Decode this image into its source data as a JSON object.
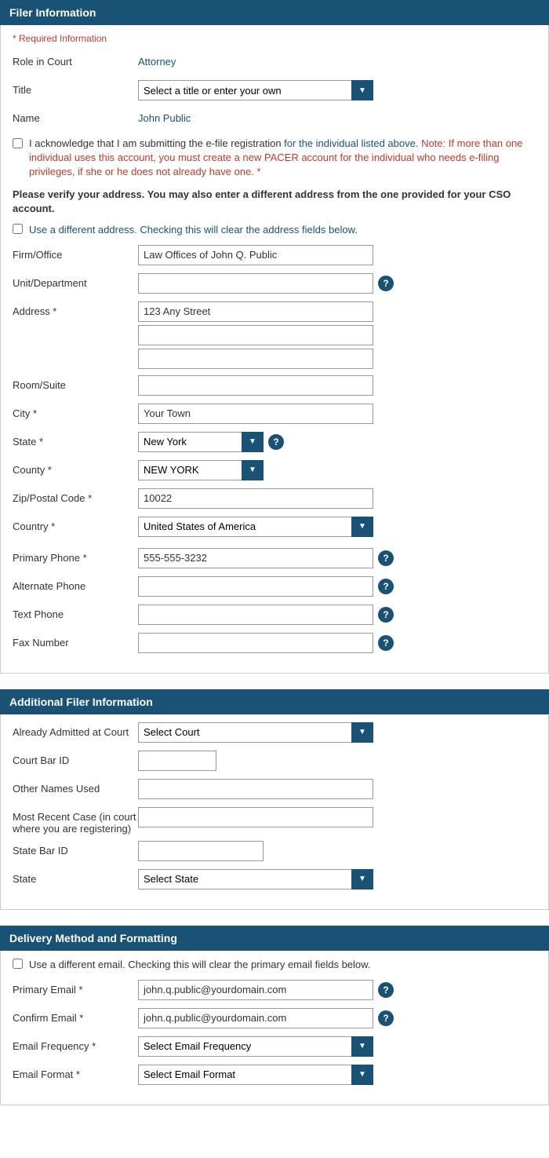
{
  "filer_section": {
    "title": "Filer Information",
    "required_label": "* Required Information",
    "role_label": "Role in Court",
    "role_value": "Attorney",
    "title_label": "Title",
    "title_placeholder": "Select a title or enter your own",
    "name_label": "Name",
    "name_value": "John Public",
    "acknowledge_text_1": "I acknowledge that I am submitting the e-file registration ",
    "acknowledge_text_2": "for the individual listed above. ",
    "acknowledge_note": "Note: If more than one individual uses this account, you must create a new PACER account for the individual who needs e-filing privileges, if she or he does not already have one. *",
    "verify_text": "Please verify your address. You may also enter a different address from the one provided for your CSO account.",
    "diff_address_text": "Use a different address. Checking this will clear the address fields below.",
    "firm_label": "Firm/Office",
    "firm_value": "Law Offices of John Q. Public",
    "unit_label": "Unit/Department",
    "address_label": "Address *",
    "address_line1": "123 Any Street",
    "address_line2": "",
    "address_line3": "",
    "room_label": "Room/Suite",
    "city_label": "City *",
    "city_value": "Your Town",
    "state_label": "State *",
    "state_value": "New York",
    "county_label": "County *",
    "county_value": "NEW YORK",
    "zip_label": "Zip/Postal Code *",
    "zip_value": "10022",
    "country_label": "Country *",
    "country_value": "United States of America",
    "primary_phone_label": "Primary Phone *",
    "primary_phone_value": "555-555-3232",
    "alt_phone_label": "Alternate Phone",
    "text_phone_label": "Text Phone",
    "fax_label": "Fax Number"
  },
  "additional_section": {
    "title": "Additional Filer Information",
    "court_label": "Already Admitted at Court",
    "court_placeholder": "Select Court",
    "bar_id_label": "Court Bar ID",
    "other_names_label": "Other Names Used",
    "recent_case_label": "Most Recent Case (in court where you are registering)",
    "state_bar_label": "State Bar ID",
    "state_label": "State",
    "state_placeholder": "Select State"
  },
  "delivery_section": {
    "title": "Delivery Method and Formatting",
    "diff_email_text": "Use a different email. Checking this will clear the primary email fields below.",
    "primary_email_label": "Primary Email *",
    "primary_email_value": "john.q.public@yourdomain.com",
    "confirm_email_label": "Confirm Email *",
    "confirm_email_value": "john.q.public@yourdomain.com",
    "frequency_label": "Email Frequency *",
    "frequency_placeholder": "Select Email Frequency",
    "format_label": "Email Format *",
    "format_placeholder": "Select Email Format"
  },
  "icons": {
    "help": "?",
    "checkbox_unchecked": "☐",
    "dropdown_arrow": "▼"
  }
}
